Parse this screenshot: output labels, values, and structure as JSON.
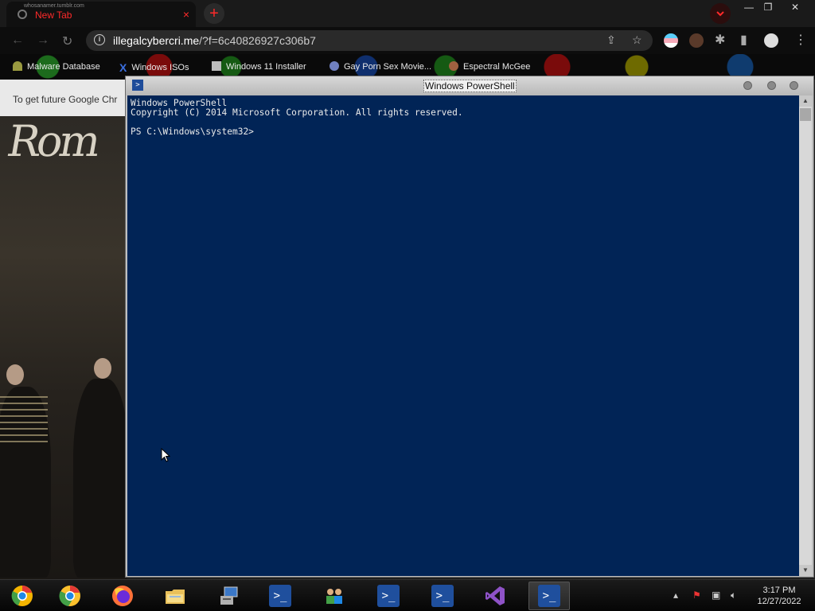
{
  "browser": {
    "tab": {
      "top_line": "whosanamer.tumblr.com",
      "title": "New Tab",
      "close": "×"
    },
    "new_tab": "+",
    "window_controls": {
      "minimize": "—",
      "restore": "❐",
      "close": "✕"
    },
    "url_host": "illegalcybercri.me",
    "url_path": "/?f=6c40826927c306b7",
    "bookmarks": [
      {
        "label": "Malware Database",
        "icon": "malware-icon",
        "color": "#9a9a40"
      },
      {
        "label": "Windows ISOs",
        "icon": "x-icon",
        "color": "#3b6fe0"
      },
      {
        "label": "Windows 11 Installer",
        "icon": "page-icon",
        "color": "#bbbbbb"
      },
      {
        "label": "Gay Porn Sex Movie...",
        "icon": "site-icon",
        "color": "#7080c0"
      },
      {
        "label": "Espectral McGee",
        "icon": "avatar-icon",
        "color": "#a06040"
      }
    ],
    "infobar_text": "To get future Google Chr",
    "page_logo": "Rom"
  },
  "powershell": {
    "title": "Windows PowerShell",
    "lines": [
      "Windows PowerShell",
      "Copyright (C) 2014 Microsoft Corporation. All rights reserved.",
      "",
      "PS C:\\Windows\\system32>"
    ]
  },
  "taskbar": {
    "buttons": [
      {
        "name": "chrome-canary-button",
        "icon": "chrome-canary-icon",
        "active": false
      },
      {
        "name": "chrome-button",
        "icon": "chrome-icon",
        "active": false
      },
      {
        "name": "firefox-button",
        "icon": "firefox-icon",
        "active": false
      },
      {
        "name": "file-explorer-button",
        "icon": "folder-icon",
        "active": false
      },
      {
        "name": "installer-button",
        "icon": "installer-icon",
        "active": false
      },
      {
        "name": "powershell-button-1",
        "icon": "powershell-icon",
        "active": false
      },
      {
        "name": "network-users-button",
        "icon": "users-icon",
        "active": false
      },
      {
        "name": "powershell-button-2",
        "icon": "powershell-icon",
        "active": false
      },
      {
        "name": "powershell-button-3",
        "icon": "powershell-icon",
        "active": false
      },
      {
        "name": "visual-studio-button",
        "icon": "visual-studio-icon",
        "active": false
      },
      {
        "name": "powershell-button-4",
        "icon": "powershell-icon",
        "active": true
      }
    ],
    "clock_time": "3:17 PM",
    "clock_date": "12/27/2022"
  },
  "colors": {
    "console_bg": "#012456",
    "console_fg": "#eaeaea",
    "tab_accent": "#ff2a2a"
  }
}
